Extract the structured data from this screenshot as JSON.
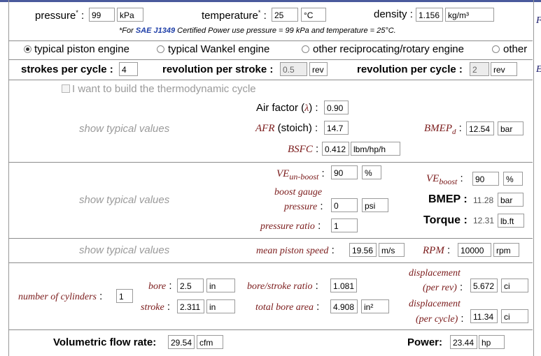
{
  "row1": {
    "pressure_label": "pressure",
    "pressure_value": "99",
    "pressure_unit": "kPa",
    "temperature_label": "temperature",
    "temperature_value": "25",
    "temperature_unit": "°C",
    "density_label": "density",
    "density_value": "1.156",
    "density_unit": "kg/m³",
    "asterisk": "*",
    "colon": ":",
    "note_pre": "*For ",
    "note_link": "SAE J1349",
    "note_post": " Certified Power use pressure = 99 kPa and temperature = 25°C."
  },
  "engine_types": [
    {
      "label": "typical piston engine",
      "selected": true
    },
    {
      "label": "typical Wankel engine",
      "selected": false
    },
    {
      "label": "other reciprocating/rotary engine",
      "selected": false
    },
    {
      "label": "other",
      "selected": false
    }
  ],
  "strokes": {
    "strokes_label": "strokes per cycle",
    "strokes_value": "4",
    "rev_stroke_label": "revolution per stroke",
    "rev_stroke_value": "0.5",
    "rev_stroke_unit": "rev",
    "rev_cycle_label": "revolution per cycle",
    "rev_cycle_value": "2",
    "rev_cycle_unit": "rev"
  },
  "thermo": {
    "checkbox_label": "I want to build the thermodynamic cycle",
    "checked": false
  },
  "sec1": {
    "show_typical": "show typical values",
    "air_factor_label": "Air factor (",
    "lambda": "λ",
    "air_factor_close": ") :",
    "air_factor_value": "0.90",
    "afr_label": "AFR",
    "afr_stoich": " (stoich) :",
    "afr_value": "14.7",
    "bsfc_label": "BSFC",
    "bsfc_value": "0.412",
    "bsfc_unit": "lbm/hp/h",
    "bmep_d_label": "BMEP",
    "bmep_d_sub": "d",
    "bmep_d_value": "12.54",
    "bmep_d_unit": "bar"
  },
  "sec2": {
    "show_typical": "show typical values",
    "ve_unboost_label": "VE",
    "ve_unboost_sub": "un-boost",
    "ve_unboost_value": "90",
    "ve_unboost_unit": "%",
    "boost_gauge_label_1": "boost gauge",
    "boost_gauge_label_2": "pressure",
    "boost_gauge_value": "0",
    "boost_gauge_unit": "psi",
    "pressure_ratio_label": "pressure ratio",
    "pressure_ratio_value": "1",
    "ve_boost_label": "VE",
    "ve_boost_sub": "boost",
    "ve_boost_value": "90",
    "ve_boost_unit": "%",
    "bmep_label": "BMEP",
    "bmep_value": "11.28",
    "bmep_unit": "bar",
    "torque_label": "Torque",
    "torque_value": "12.31",
    "torque_unit": "lb.ft"
  },
  "sec3": {
    "show_typical": "show typical values",
    "mps_label": "mean piston speed",
    "mps_value": "19.56",
    "mps_unit": "m/s",
    "rpm_label": "RPM",
    "rpm_value": "10000",
    "rpm_unit": "rpm"
  },
  "sec4": {
    "cyl_label": "number of cylinders",
    "cyl_value": "1",
    "bore_label": "bore",
    "bore_value": "2.5",
    "bore_unit": "in",
    "stroke_label": "stroke",
    "stroke_value": "2.311",
    "stroke_unit": "in",
    "bsr_label": "bore/stroke ratio",
    "bsr_value": "1.081",
    "tba_label": "total bore area",
    "tba_value": "4.908",
    "tba_unit": "in²",
    "disp_rev_label_1": "displacement",
    "disp_rev_label_2": "(per rev)",
    "disp_rev_value": "5.672",
    "disp_rev_unit": "ci",
    "disp_cyc_label_1": "displacement",
    "disp_cyc_label_2": "(per cycle)",
    "disp_cyc_value": "11.34",
    "disp_cyc_unit": "ci"
  },
  "bottom": {
    "vfr_label": "Volumetric flow rate:",
    "vfr_value": "29.54",
    "vfr_unit": "cfm",
    "power_label": "Power:",
    "power_value": "23.44",
    "power_unit": "hp"
  },
  "edge": {
    "top_glyph": "F",
    "mid_glyph": "E"
  }
}
